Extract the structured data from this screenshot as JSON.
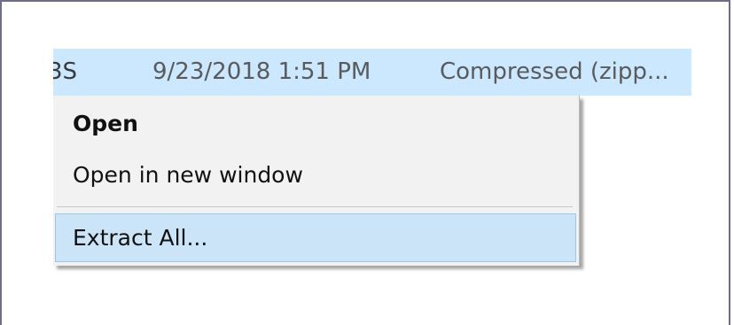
{
  "file_row": {
    "name_partial": "3S",
    "date_modified": "9/23/2018 1:51 PM",
    "type": "Compressed (zipp..."
  },
  "context_menu": {
    "items": [
      {
        "label": "Open",
        "bold": true
      },
      {
        "label": "Open in new window"
      },
      {
        "label": "Extract All...",
        "highlighted": true
      }
    ]
  },
  "colors": {
    "row_selected": "#cce8ff",
    "menu_background": "#f2f2f2",
    "menu_item_hover": "#cce4f7",
    "frame_border": "#6e6e8a"
  }
}
